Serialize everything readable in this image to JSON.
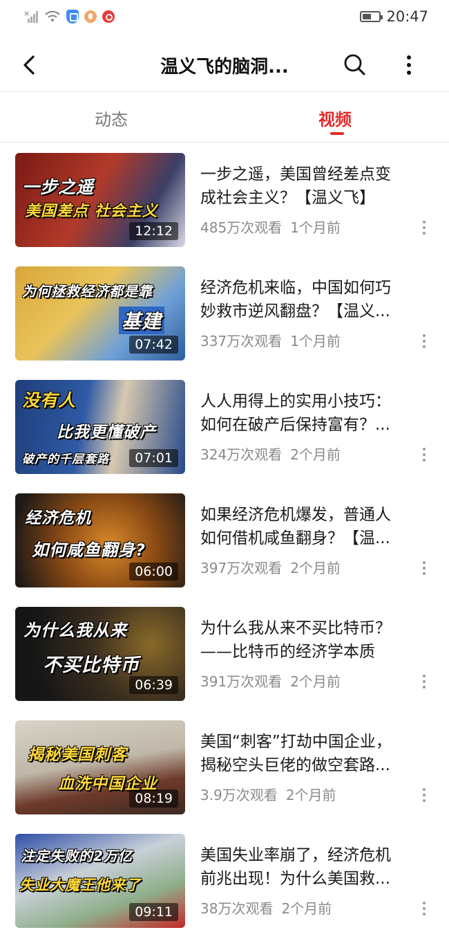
{
  "status_bar": {
    "time": "20:47"
  },
  "header": {
    "title": "温义飞的脑洞..."
  },
  "tabs": [
    {
      "label": "动态",
      "active": false
    },
    {
      "label": "视频",
      "active": true
    }
  ],
  "accent_color": "#e52a2a",
  "videos": [
    {
      "thumb_text": [
        "一步之遥",
        "美国差点 社会主义"
      ],
      "duration": "12:12",
      "title_lines": [
        "一步之遥，美国曾经差点变",
        "成社会主义？【温义飞】"
      ],
      "views": "485万次观看",
      "age": "1个月前"
    },
    {
      "thumb_text": [
        "为何拯救经济都是靠",
        "基建"
      ],
      "duration": "07:42",
      "title_lines": [
        "经济危机来临，中国如何巧",
        "妙救市逆风翻盘？【温义..."
      ],
      "views": "337万次观看",
      "age": "1个月前"
    },
    {
      "thumb_text": [
        "没有人",
        "比我更懂破产",
        "破产的千层套路"
      ],
      "duration": "07:01",
      "title_lines": [
        "人人用得上的实用小技巧：",
        "如何在破产后保持富有？..."
      ],
      "views": "324万次观看",
      "age": "2个月前"
    },
    {
      "thumb_text": [
        "经济危机",
        "如何咸鱼翻身?"
      ],
      "duration": "06:00",
      "title_lines": [
        "如果经济危机爆发，普通人",
        "如何借机咸鱼翻身？【温..."
      ],
      "views": "397万次观看",
      "age": "2个月前"
    },
    {
      "thumb_text": [
        "为什么我从来",
        "不买比特币"
      ],
      "duration": "06:39",
      "title_lines": [
        "为什么我从来不买比特币？",
        "——比特币的经济学本质"
      ],
      "views": "391万次观看",
      "age": "2个月前"
    },
    {
      "thumb_text": [
        "揭秘美国刺客",
        "血洗中国企业"
      ],
      "duration": "08:19",
      "title_lines": [
        "美国“刺客”打劫中国企业，",
        "揭秘空头巨佬的做空套路..."
      ],
      "views": "3.9万次观看",
      "age": "2个月前"
    },
    {
      "thumb_text": [
        "注定失败的2万亿",
        "失业大魔王他来了"
      ],
      "duration": "09:11",
      "title_lines": [
        "美国失业率崩了，经济危机",
        "前兆出现！为什么美国救..."
      ],
      "views": "38万次观看",
      "age": "2个月前"
    }
  ]
}
